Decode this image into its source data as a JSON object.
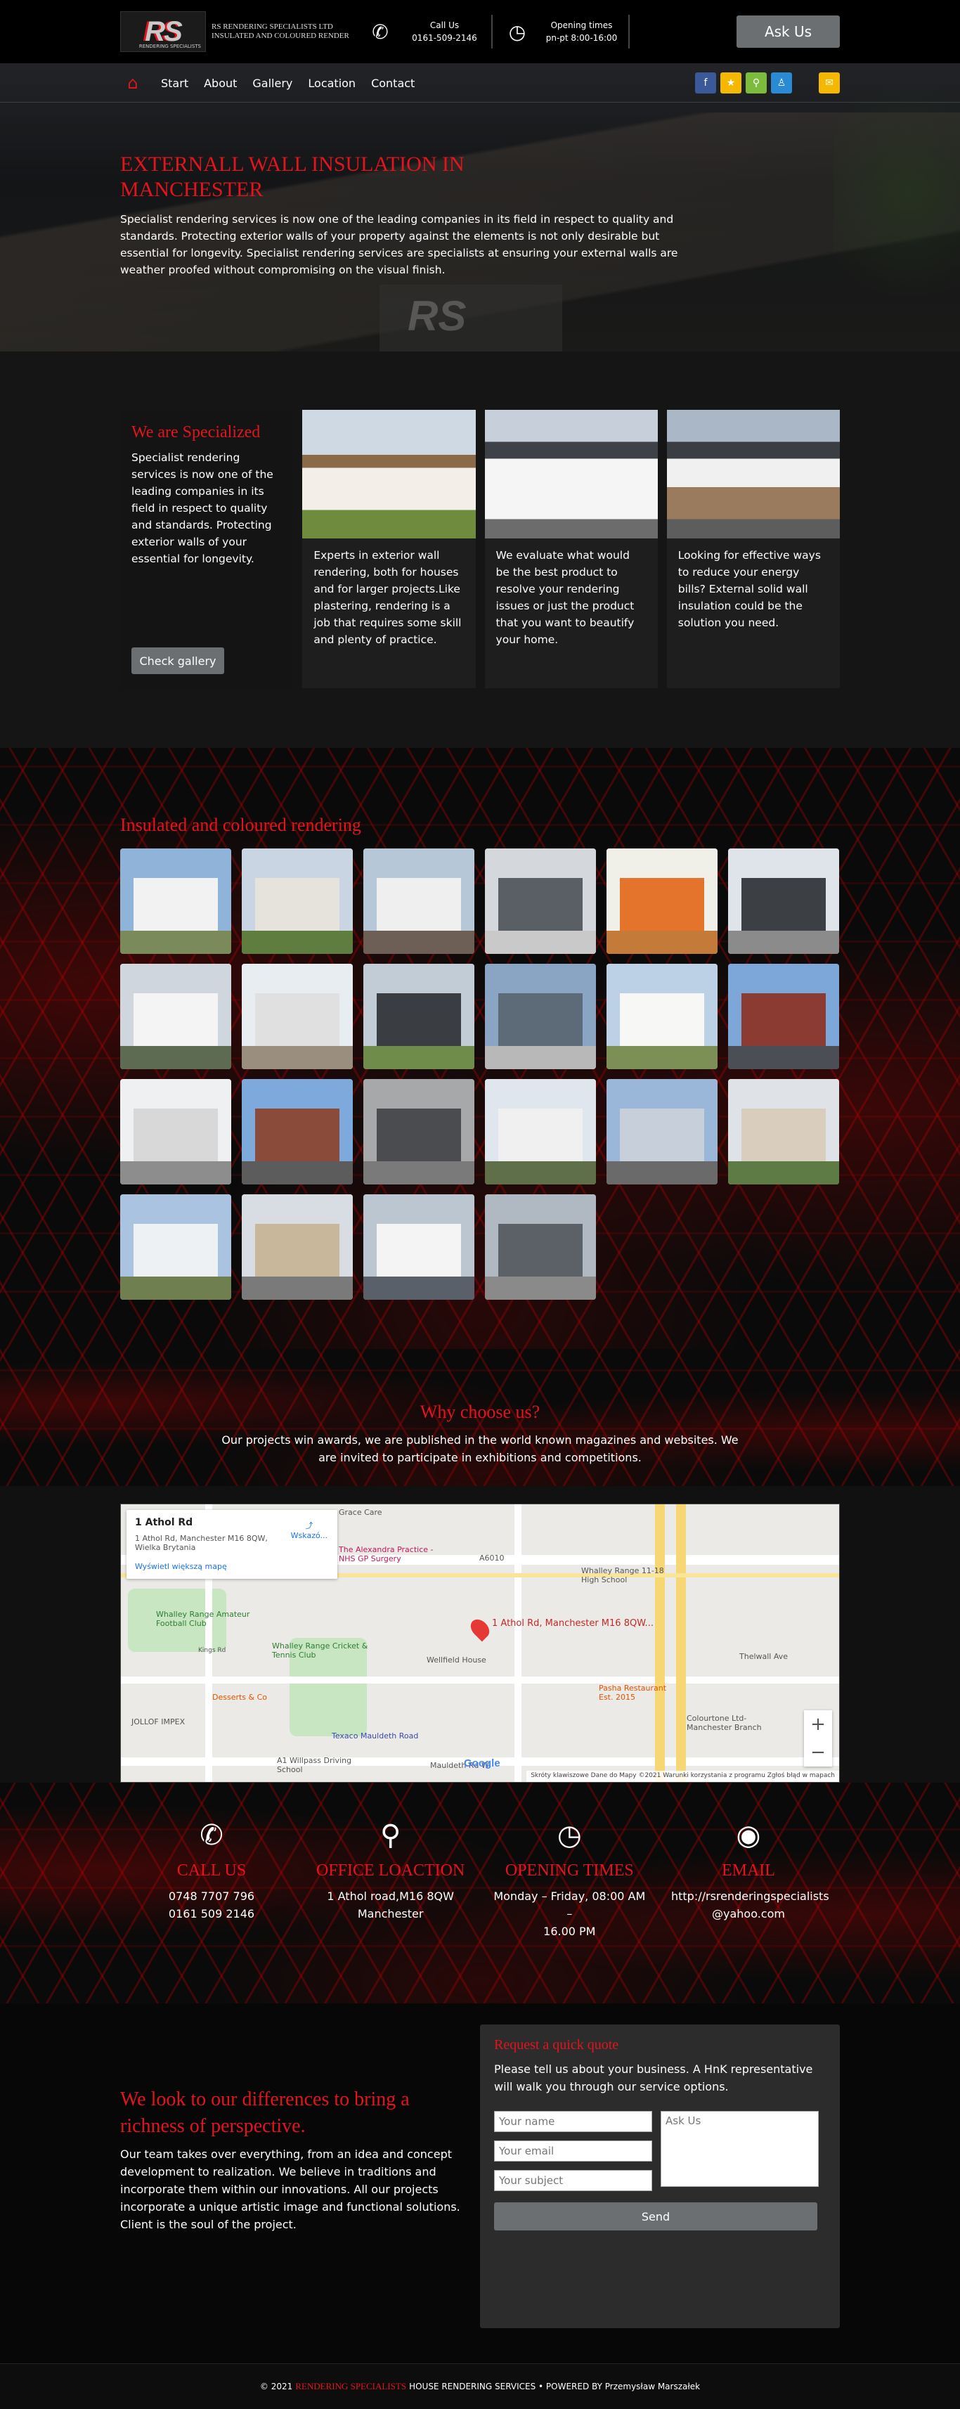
{
  "header": {
    "logo_text": "RS",
    "logo_tagline": "RENDERING SPECIALISTS",
    "company_name": "RS RENDERING SPECIALISTS LTD INSULATED AND COLOURED RENDER",
    "call_label": "Call Us",
    "call_number": "0161-509-2146",
    "hours_label": "Opening times",
    "hours_value": "pn-pt 8:00-16:00",
    "ask_button": "Ask Us"
  },
  "nav": {
    "items": [
      "Start",
      "About",
      "Gallery",
      "Location",
      "Contact"
    ],
    "social_colors": [
      "#3b5998",
      "#f5b800",
      "#7cbb3b",
      "#2a8bd4"
    ],
    "chat_color": "#f5b800"
  },
  "hero": {
    "title": "EXTERNALL WALL INSULATION IN MANCHESTER",
    "text": "Specialist rendering services is now one of the leading companies in its field in respect to quality and standards. Protecting exterior walls of your property against the elements is not only desirable but essential for longevity. Specialist rendering services are specialists at ensuring your external walls are weather proofed without compromising on the visual finish."
  },
  "specialized": {
    "title": "We are Specialized",
    "text": "Specialist rendering services is now one of the leading companies in its field in respect to quality and standards. Protecting exterior walls of your essential for longevity.",
    "button": "Check gallery",
    "cards": [
      "Experts in exterior wall rendering, both for houses and for larger projects.Like plastering, rendering is a job that requires some skill and plenty of practice.",
      "We evaluate what would be the best product to resolve your rendering issues or just the product that you want to beautify your home.",
      "Looking for effective ways to reduce your energy bills? External solid wall insulation could be the solution you need."
    ]
  },
  "gallery": {
    "title": "Insulated and coloured rendering",
    "thumbs": [
      {
        "sky": "#8fb3d9",
        "bld": "#f2f2f2",
        "grd": "#7a8a5a"
      },
      {
        "sky": "#c9d5e3",
        "bld": "#e6e2dc",
        "grd": "#5f7d3e"
      },
      {
        "sky": "#b6c7d8",
        "bld": "#efefef",
        "grd": "#6d5f55"
      },
      {
        "sky": "#d4d8dc",
        "bld": "#5a5f66",
        "grd": "#c9c9c9"
      },
      {
        "sky": "#f0efe8",
        "bld": "#e4742c",
        "grd": "#c47b3a"
      },
      {
        "sky": "#dfe4ea",
        "bld": "#3c3f44",
        "grd": "#8b8b8b"
      },
      {
        "sky": "#cfd6de",
        "bld": "#f4f4f4",
        "grd": "#5d6b52"
      },
      {
        "sky": "#e8edf2",
        "bld": "#e0e0e0",
        "grd": "#9a8f7e"
      },
      {
        "sky": "#c2ccd6",
        "bld": "#3a3d42",
        "grd": "#6f8c4a"
      },
      {
        "sky": "#8aa5c4",
        "bld": "#5d6a78",
        "grd": "#b8b8b8"
      },
      {
        "sky": "#bcd0e6",
        "bld": "#f7f7f5",
        "grd": "#7c8f55"
      },
      {
        "sky": "#7ea7d9",
        "bld": "#8c3b32",
        "grd": "#4b4e55"
      },
      {
        "sky": "#eef0f2",
        "bld": "#d8d8d8",
        "grd": "#8d8d8d"
      },
      {
        "sky": "#7ea9dc",
        "bld": "#8a4b3a",
        "grd": "#5c5c5c"
      },
      {
        "sky": "#a6a8aa",
        "bld": "#4a4c50",
        "grd": "#7a7a7a"
      },
      {
        "sky": "#dfe6ee",
        "bld": "#f0f0f0",
        "grd": "#5f6f4a"
      },
      {
        "sky": "#9ab7d9",
        "bld": "#c7d0da",
        "grd": "#6a6a6a"
      },
      {
        "sky": "#dfe3e8",
        "bld": "#d9cdbd",
        "grd": "#5e7a45"
      },
      {
        "sky": "#a9c3e0",
        "bld": "#eef1f4",
        "grd": "#6f7f50"
      },
      {
        "sky": "#d8dde3",
        "bld": "#c9b79c",
        "grd": "#7a7a7a"
      },
      {
        "sky": "#bcc6d0",
        "bld": "#f4f4f4",
        "grd": "#59606a"
      },
      {
        "sky": "#b0b9c2",
        "bld": "#5c6168",
        "grd": "#8a8a8a"
      }
    ]
  },
  "why": {
    "title": "Why choose us?",
    "text": "Our projects win awards, we are published in the world known magazines and websites. We are invited to participate in exhibitions and competitions."
  },
  "map": {
    "place_title": "1 Athol Rd",
    "place_address": "1 Athol Rd, Manchester M16 8QW, Wielka Brytania",
    "larger_map": "Wyświetl większą mapę",
    "directions": "Wskazó...",
    "pin_label": "1 Athol Rd, Manchester M16 8QW...",
    "labels": [
      "Grace Care",
      "The Alexandra Practice - NHS GP Surgery",
      "Whalley Range 11-18 High School",
      "Whalley Range Amateur Football Club",
      "Whalley Range Cricket & Tennis Club",
      "Wellfield House",
      "Pasha Restaurant Est. 2015",
      "Desserts & Co",
      "JOLLOF IMPEX",
      "Texaco Mauldeth Road",
      "Colourtone Ltd-Manchester Branch",
      "A1 Willpass Driving School",
      "A6010",
      "Kings Rd",
      "Thelwall Ave",
      "Mauldeth Rd W"
    ],
    "footer": "Skróty klawiszowe   Dane do Mapy ©2021   Warunki korzystania z programu   Zgłoś błąd w mapach",
    "google": "Google"
  },
  "contact": [
    {
      "icon": "phone-icon",
      "glyph": "✆",
      "title": "CALL US",
      "lines": [
        "0748 7707 796",
        "0161 509 2146"
      ]
    },
    {
      "icon": "location-pin-icon",
      "glyph": "⚲",
      "title": "OFFICE LOACTION",
      "lines": [
        "1 Athol road,M16 8QW",
        "Manchester"
      ]
    },
    {
      "icon": "clock-icon",
      "glyph": "◷",
      "title": "OPENING TIMES",
      "lines": [
        "Monday – Friday, 08:00 AM –",
        "16.00 PM"
      ]
    },
    {
      "icon": "globe-icon",
      "glyph": "◉",
      "title": "EMAIL",
      "lines": [
        "http://rsrenderingspecialists",
        "@yahoo.com"
      ]
    }
  ],
  "quote": {
    "left_title": "We look to our differences to bring a richness of perspective.",
    "left_text": "Our team takes over everything, from an idea and concept development to realization. We believe in traditions and incorporate them within our innovations. All our projects incorporate a unique artistic image and functional solutions. Client is the soul of the project.",
    "form_title": "Request a quick quote",
    "form_text": "Please tell us about your business. A HnK representative will walk you through our service options.",
    "name_placeholder": "Your name",
    "email_placeholder": "Your email",
    "subject_placeholder": "Your subject",
    "message_placeholder": "Ask Us",
    "send": "Send"
  },
  "footer": {
    "prefix": "© 2021",
    "brand": "RENDERING SPECIALISTS",
    "suffix": "HOUSE RENDERING SERVICES • POWERED BY Przemysław Marszałek"
  }
}
